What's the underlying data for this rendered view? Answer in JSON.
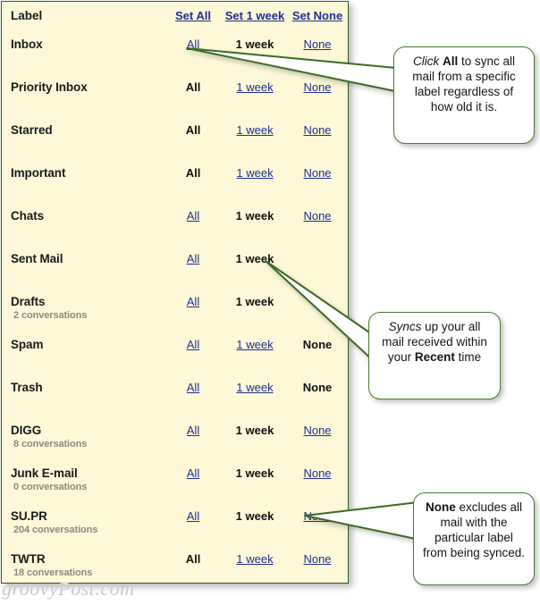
{
  "panel": {
    "header": {
      "label_col": "Label",
      "set_all": "Set All",
      "set_week": "Set 1 week",
      "set_none": "Set None"
    },
    "rows": [
      {
        "name": "Inbox",
        "sub": "",
        "all": "All",
        "week": "1 week",
        "none": "None",
        "active": "week",
        "hide_none": false
      },
      {
        "name": "Priority Inbox",
        "sub": "",
        "all": "All",
        "week": "1 week",
        "none": "None",
        "active": "all",
        "hide_none": false
      },
      {
        "name": "Starred",
        "sub": "",
        "all": "All",
        "week": "1 week",
        "none": "None",
        "active": "all",
        "hide_none": false
      },
      {
        "name": "Important",
        "sub": "",
        "all": "All",
        "week": "1 week",
        "none": "None",
        "active": "all",
        "hide_none": false
      },
      {
        "name": "Chats",
        "sub": "",
        "all": "All",
        "week": "1 week",
        "none": "None",
        "active": "week",
        "hide_none": false
      },
      {
        "name": "Sent Mail",
        "sub": "",
        "all": "All",
        "week": "1 week",
        "none": "",
        "active": "week",
        "hide_none": true
      },
      {
        "name": "Drafts",
        "sub": "2 conversations",
        "all": "All",
        "week": "1 week",
        "none": "",
        "active": "week",
        "hide_none": true
      },
      {
        "name": "Spam",
        "sub": "",
        "all": "All",
        "week": "1 week",
        "none": "None",
        "active": "none",
        "hide_none": false
      },
      {
        "name": "Trash",
        "sub": "",
        "all": "All",
        "week": "1 week",
        "none": "None",
        "active": "none",
        "hide_none": false
      },
      {
        "name": "DIGG",
        "sub": "8 conversations",
        "all": "All",
        "week": "1 week",
        "none": "None",
        "active": "week",
        "hide_none": false
      },
      {
        "name": "Junk E-mail",
        "sub": "0 conversations",
        "all": "All",
        "week": "1 week",
        "none": "None",
        "active": "week",
        "hide_none": false
      },
      {
        "name": "SU.PR",
        "sub": "204 conversations",
        "all": "All",
        "week": "1 week",
        "none": "None",
        "active": "week",
        "hide_none": false
      },
      {
        "name": "TWTR",
        "sub": "18 conversations",
        "all": "All",
        "week": "1 week",
        "none": "None",
        "active": "all",
        "hide_none": false
      }
    ]
  },
  "callouts": [
    {
      "id": "callout-all",
      "parts": [
        {
          "text": "Click ",
          "style": "italic"
        },
        {
          "text": "All",
          "style": "bold"
        },
        {
          "text": " to sync all mail from a specific label regardless of how old it is.",
          "style": "normal"
        }
      ]
    },
    {
      "id": "callout-week",
      "parts": [
        {
          "text": "Syncs",
          "style": "italic"
        },
        {
          "text": " up your all mail received within your ",
          "style": "normal"
        },
        {
          "text": "Recent",
          "style": "bold"
        },
        {
          "text": " time",
          "style": "normal"
        }
      ]
    },
    {
      "id": "callout-none",
      "parts": [
        {
          "text": "None",
          "style": "bold"
        },
        {
          "text": " excludes all mail with the particular label from being synced.",
          "style": "normal"
        }
      ]
    }
  ],
  "watermark": "groovyPost.com",
  "colors": {
    "panel_bg": "#fcf8d8",
    "panel_border": "#2f5b22",
    "link": "#1f2f8f",
    "active_text": "#111111",
    "sub_text": "#8c8c78",
    "callout_border": "#4a7a2b",
    "arrow_stroke": "#3c6b26",
    "arrow_fill": "#ffffff"
  }
}
